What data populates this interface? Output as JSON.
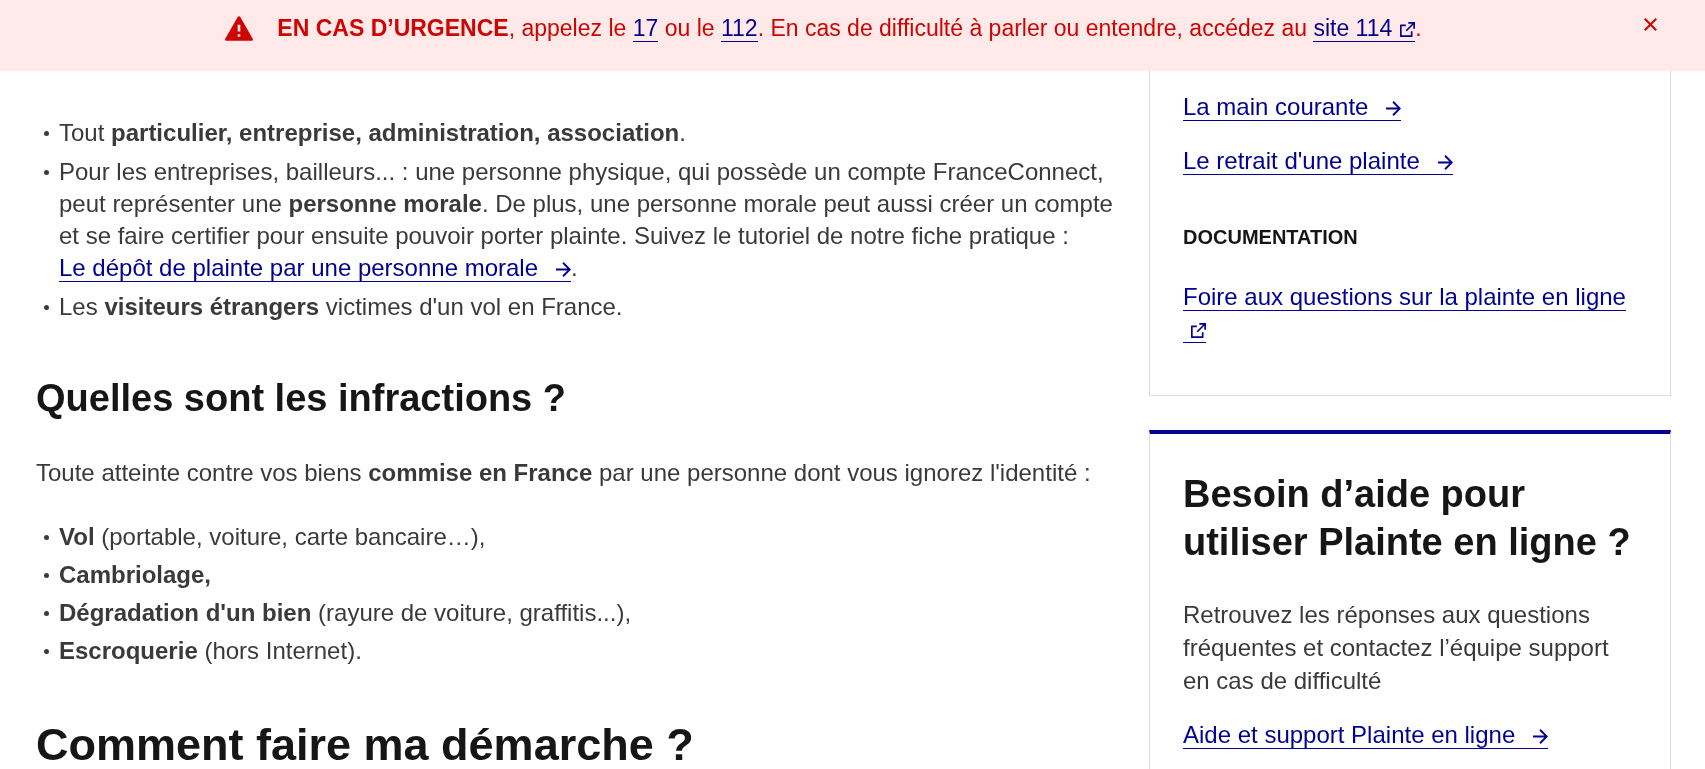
{
  "alert_banner": {
    "parts": [
      {
        "kind": "text",
        "text": "**EN CAS D’URGENCE**, appelez le "
      },
      {
        "kind": "link",
        "text": "17"
      },
      {
        "kind": "text",
        "text": " ou le "
      },
      {
        "kind": "link",
        "text": "112"
      },
      {
        "kind": "text",
        "text": ". En cas de difficulté à parler ou entendre, accédez au "
      },
      {
        "kind": "external_link",
        "text": "site 114"
      },
      {
        "kind": "text",
        "text": "."
      }
    ]
  },
  "concerned": {
    "items": [
      {
        "parts": [
          {
            "kind": "text",
            "text": "Tout **particulier, entreprise, administration, association**."
          }
        ]
      },
      {
        "parts": [
          {
            "kind": "text",
            "text": "Pour les entreprises, bailleurs... : une personne physique, qui possède un compte FranceConnect, peut représenter une **personne morale**. De plus, une personne morale peut aussi créer un compte et se faire certifier pour ensuite pouvoir porter plainte. Suivez le tutoriel de notre fiche pratique : "
          },
          {
            "kind": "arrow_link",
            "text": "Le dépôt de plainte par une personne morale"
          },
          {
            "kind": "text",
            "text": "."
          }
        ]
      },
      {
        "parts": [
          {
            "kind": "text",
            "text": "Les **visiteurs étrangers** victimes d'un vol en France."
          }
        ]
      }
    ]
  },
  "infractions": {
    "title": "Quelles sont les infractions ?",
    "intro": "Toute atteinte contre vos biens **commise en France** par une personne dont vous ignorez l'identité :",
    "items": [
      "**Vol** (portable, voiture, carte bancaire…),",
      "**Cambriolage,**",
      "**Dégradation d'un bien** (rayure de voiture, graffitis...),",
      "**Escroquerie** (hors Internet)."
    ]
  },
  "next_section": {
    "title": "Comment faire ma démarche ?"
  },
  "sidebar": {
    "links": [
      {
        "kind": "arrow_link",
        "text": "La main courante"
      },
      {
        "kind": "arrow_link",
        "text": "Le retrait d'une plainte"
      }
    ],
    "sections": [
      {
        "title": "DOCUMENTATION",
        "links": [
          {
            "kind": "external_link",
            "text": "Foire aux questions sur la plainte en ligne"
          }
        ]
      }
    ]
  },
  "help_card": {
    "title": "Besoin d’aide pour utiliser Plainte en ligne ?",
    "text": "Retrouvez les réponses aux questions fréquentes et contactez l’équipe support en cas de difficulté",
    "link": {
      "kind": "arrow_link",
      "text": "Aide et support Plainte en ligne"
    }
  }
}
